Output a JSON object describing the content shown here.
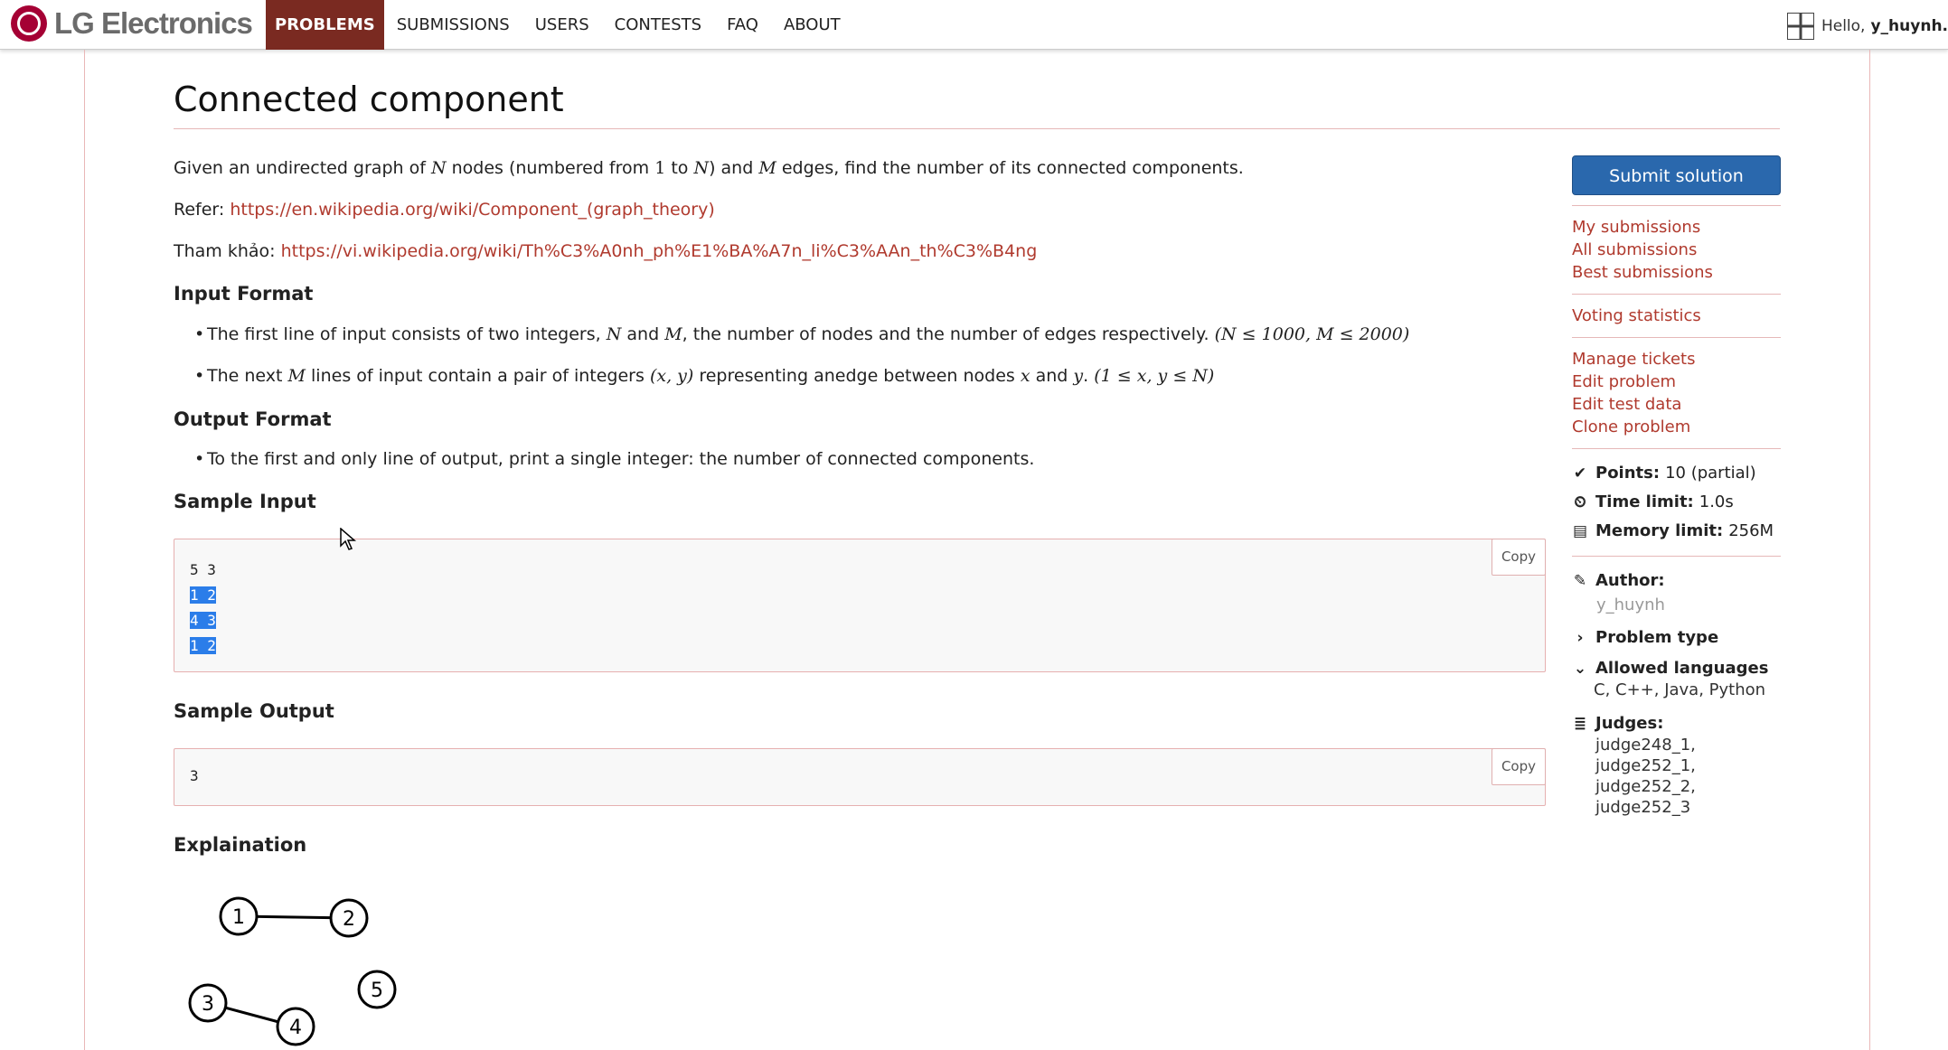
{
  "header": {
    "brand": "LG Electronics",
    "nav": [
      "PROBLEMS",
      "SUBMISSIONS",
      "USERS",
      "CONTESTS",
      "FAQ",
      "ABOUT"
    ],
    "greeting": "Hello,",
    "username": "y_huynh."
  },
  "problem": {
    "title": "Connected component",
    "intro_1": "Given an undirected graph of",
    "intro_N": "N",
    "intro_2": "nodes (numbered from",
    "intro_one": "1",
    "intro_to": "to",
    "intro_N2": "N",
    "intro_3": ") and",
    "intro_M": "M",
    "intro_4": "edges, find the number of its connected components.",
    "refer_label": "Refer:",
    "refer_url": "https://en.wikipedia.org/wiki/Component_(graph_theory)",
    "refer_vi_label": "Tham khảo:",
    "refer_vi_url": "https://vi.wikipedia.org/wiki/Th%C3%A0nh_ph%E1%BA%A7n_li%C3%AAn_th%C3%B4ng",
    "input_heading": "Input Format",
    "input_1a": "The first line of input consists of two integers,",
    "input_1N": "N",
    "input_1and": "and",
    "input_1M": "M",
    "input_1b": ", the number of nodes and the number of edges respectively.",
    "input_1c": "(N ≤ 1000, M ≤ 2000)",
    "input_2a": "The next",
    "input_2M": "M",
    "input_2b": "lines of input contain a pair of integers",
    "input_2xy": "(x, y)",
    "input_2c": "representing anedge between nodes",
    "input_2x": "x",
    "input_2and": "and",
    "input_2y": "y",
    "input_2d": ".",
    "input_2e": "(1 ≤ x, y ≤ N)",
    "output_heading": "Output Format",
    "output_1": "To the first and only line of output, print a single integer: the number of connected components.",
    "sample_input_heading": "Sample Input",
    "sample_input_lines": [
      "5 3",
      "1 2",
      "4 3",
      "1 2"
    ],
    "sample_output_heading": "Sample Output",
    "sample_output": "3",
    "copy_label": "Copy",
    "explanation_heading": "Explaination",
    "graph_nodes": [
      "1",
      "2",
      "3",
      "4",
      "5"
    ],
    "graph_edges": [
      [
        "1",
        "2"
      ],
      [
        "3",
        "4"
      ]
    ]
  },
  "sidebar": {
    "submit": "Submit solution",
    "links_group1": [
      "My submissions",
      "All submissions",
      "Best submissions"
    ],
    "links_group2": [
      "Voting statistics"
    ],
    "links_group3": [
      "Manage tickets",
      "Edit problem",
      "Edit test data",
      "Clone problem"
    ],
    "points_label": "Points:",
    "points_value": "10 (partial)",
    "time_label": "Time limit:",
    "time_value": "1.0s",
    "memory_label": "Memory limit:",
    "memory_value": "256M",
    "author_label": "Author:",
    "author_value": "y_huynh",
    "problem_type_label": "Problem type",
    "allowed_label": "Allowed languages",
    "allowed_value": "C, C++, Java, Python",
    "judges_label": "Judges:",
    "judges_line1": "judge248_1, judge252_1,",
    "judges_line2": "judge252_2, judge252_3"
  },
  "colors": {
    "accent": "#7a2a21",
    "link": "#b03a2e",
    "button": "#2a68ad"
  },
  "icons": [
    "check-icon",
    "clock-icon",
    "memory-icon",
    "edit-icon",
    "chevron-right-icon",
    "chevron-down-icon",
    "database-icon"
  ]
}
